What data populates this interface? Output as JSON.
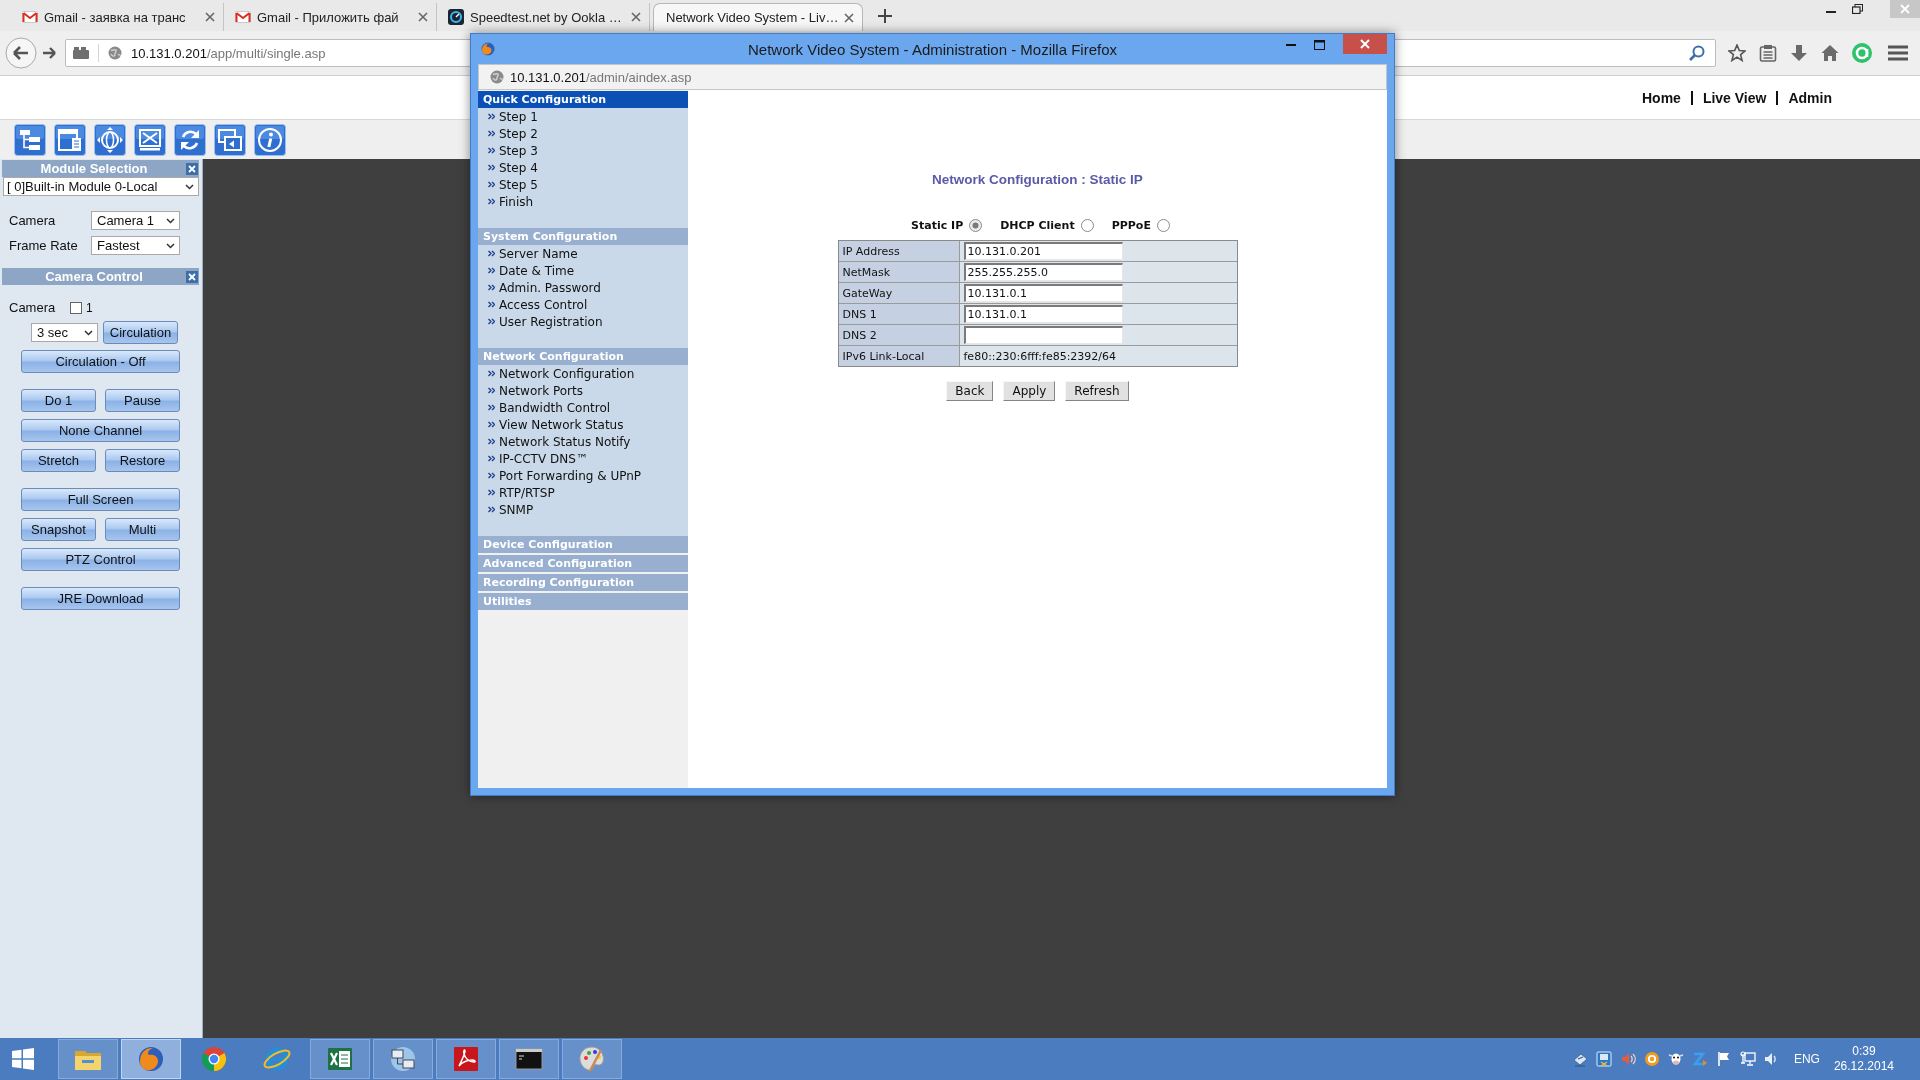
{
  "browser": {
    "tabs": [
      {
        "kind": "mail",
        "label": "Gmail - заявка на транс",
        "selected": false
      },
      {
        "kind": "mail",
        "label": "Gmail - Приложить фай",
        "selected": false
      },
      {
        "kind": "gauge",
        "label": "Speedtest.net by Ookla …",
        "selected": false
      },
      {
        "kind": "none",
        "label": "Network Video System - Liv…",
        "selected": true
      }
    ],
    "address": {
      "host": "10.131.0.201",
      "path": "/app/multi/single.asp"
    }
  },
  "page": {
    "nav_links": [
      "Home",
      "Live View",
      "Admin"
    ]
  },
  "left_panel": {
    "module_selection": {
      "title": "Module Selection",
      "module": "[ 0]Built-in Module 0-Local"
    },
    "settings": [
      {
        "label": "Camera",
        "value": "Camera 1"
      },
      {
        "label": "Frame Rate",
        "value": "Fastest"
      }
    ],
    "camera_control": {
      "title": "Camera Control",
      "camera_label": "Camera",
      "checkbox": {
        "label": "1",
        "checked": false
      },
      "interval": "3 sec",
      "circulation_button": "Circulation",
      "button_groups": [
        [
          [
            "Circulation - Off"
          ]
        ],
        [
          [
            "Do 1",
            "Pause"
          ],
          [
            "None Channel"
          ],
          [
            "Stretch",
            "Restore"
          ]
        ],
        [
          [
            "Full Screen"
          ],
          [
            "Snapshot",
            "Multi"
          ],
          [
            "PTZ Control"
          ]
        ],
        [
          [
            "JRE Download"
          ]
        ]
      ]
    }
  },
  "popup": {
    "title": "Network Video System - Administration - Mozilla Firefox",
    "address": {
      "host": "10.131.0.201",
      "path": "/admin/aindex.asp"
    },
    "menu": [
      {
        "title": "Quick Configuration",
        "selected": true,
        "items": [
          "Step 1",
          "Step 2",
          "Step 3",
          "Step 4",
          "Step 5",
          "Finish"
        ]
      },
      {
        "title": "System Configuration",
        "selected": false,
        "items": [
          "Server Name",
          "Date & Time",
          "Admin. Password",
          "Access Control",
          "User Registration"
        ]
      },
      {
        "title": "Network Configuration",
        "selected": false,
        "items": [
          "Network Configuration",
          "Network Ports",
          "Bandwidth Control",
          "View Network Status",
          "Network Status Notify",
          "IP-CCTV DNS™",
          "Port Forwarding & UPnP",
          "RTP/RTSP",
          "SNMP"
        ]
      },
      {
        "title": "Device Configuration",
        "selected": false
      },
      {
        "title": "Advanced Configuration",
        "selected": false
      },
      {
        "title": "Recording Configuration",
        "selected": false
      },
      {
        "title": "Utilities",
        "selected": false
      }
    ],
    "form": {
      "title": "Network Configuration : Static IP",
      "modes": [
        {
          "label": "Static IP",
          "selected": true
        },
        {
          "label": "DHCP Client",
          "selected": false
        },
        {
          "label": "PPPoE",
          "selected": false
        }
      ],
      "fields": [
        {
          "kind": "input",
          "label": "IP Address",
          "value": "10.131.0.201"
        },
        {
          "kind": "input",
          "label": "NetMask",
          "value": "255.255.255.0"
        },
        {
          "kind": "input",
          "label": "GateWay",
          "value": "10.131.0.1"
        },
        {
          "kind": "input",
          "label": "DNS 1",
          "value": "10.131.0.1"
        },
        {
          "kind": "input",
          "label": "DNS 2"
        },
        {
          "kind": "text",
          "label": "IPv6 Link-Local",
          "value": "fe80::230:6fff:fe85:2392/64"
        }
      ],
      "buttons": [
        "Back",
        "Apply",
        "Refresh"
      ]
    }
  },
  "taskbar": {
    "apps": [
      {
        "kind": "folder",
        "running": true,
        "selected": false
      },
      {
        "kind": "fox",
        "running": true,
        "selected": true
      },
      {
        "kind": "segments",
        "running": false,
        "selected": false
      },
      {
        "kind": "orbit",
        "running": false,
        "selected": false
      },
      {
        "kind": "sheet",
        "running": true,
        "selected": false
      },
      {
        "kind": "network",
        "running": true,
        "selected": false
      },
      {
        "kind": "document",
        "running": true,
        "selected": false
      },
      {
        "kind": "terminal",
        "running": true,
        "selected": false
      },
      {
        "kind": "palette",
        "running": true,
        "selected": false
      }
    ],
    "tray": {
      "language": "ENG",
      "time": "0:39",
      "date": "26.12.2014"
    }
  }
}
